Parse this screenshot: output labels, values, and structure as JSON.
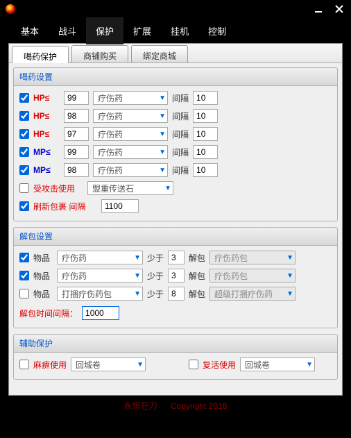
{
  "titlebar": {
    "app_name": ""
  },
  "menu": {
    "items": [
      "基本",
      "战斗",
      "保护",
      "扩展",
      "挂机",
      "控制"
    ],
    "active": 2
  },
  "sub_tabs": {
    "items": [
      "喝药保护",
      "商铺购买",
      "绑定商城"
    ],
    "active": 0
  },
  "potion_group": {
    "title": "喝药设置",
    "interval_label": "间隔",
    "rows": [
      {
        "checked": true,
        "label": "HP≤",
        "type": "hp",
        "value": "99",
        "item": "疗伤药",
        "interval": "10"
      },
      {
        "checked": true,
        "label": "HP≤",
        "type": "hp",
        "value": "98",
        "item": "疗伤药",
        "interval": "10"
      },
      {
        "checked": true,
        "label": "HP≤",
        "type": "hp",
        "value": "97",
        "item": "疗伤药",
        "interval": "10"
      },
      {
        "checked": true,
        "label": "MP≤",
        "type": "mp",
        "value": "99",
        "item": "疗伤药",
        "interval": "10"
      },
      {
        "checked": true,
        "label": "MP≤",
        "type": "mp",
        "value": "98",
        "item": "疗伤药",
        "interval": "10"
      }
    ],
    "attack_use": {
      "checked": false,
      "label": "受攻击使用",
      "item": "盟重传送石"
    },
    "refresh_bag": {
      "checked": true,
      "label": "刷新包裹 间隔",
      "value": "1100"
    }
  },
  "unpack_group": {
    "title": "解包设置",
    "less_label": "少于",
    "unpack_label": "解包",
    "rows": [
      {
        "checked": true,
        "label": "物品",
        "item": "疗伤药",
        "qty": "3",
        "pack": "疗伤药包",
        "pack_disabled": true
      },
      {
        "checked": true,
        "label": "物品",
        "item": "疗伤药",
        "qty": "3",
        "pack": "疗伤药包",
        "pack_disabled": true
      },
      {
        "checked": false,
        "label": "物品",
        "item": "打捆疗伤药包",
        "qty": "8",
        "pack": "超级打捆疗伤药",
        "pack_disabled": true
      }
    ],
    "interval": {
      "label": "解包时间间隔：",
      "value": "1000"
    }
  },
  "assist_group": {
    "title": "辅助保护",
    "paralyze": {
      "checked": false,
      "label": "麻痹使用",
      "item": "回城卷"
    },
    "revive": {
      "checked": false,
      "label": "复活使用",
      "item": "回城卷"
    }
  },
  "footer": {
    "brand": "永恒狂刀",
    "copyright": "Copyright 2018"
  }
}
